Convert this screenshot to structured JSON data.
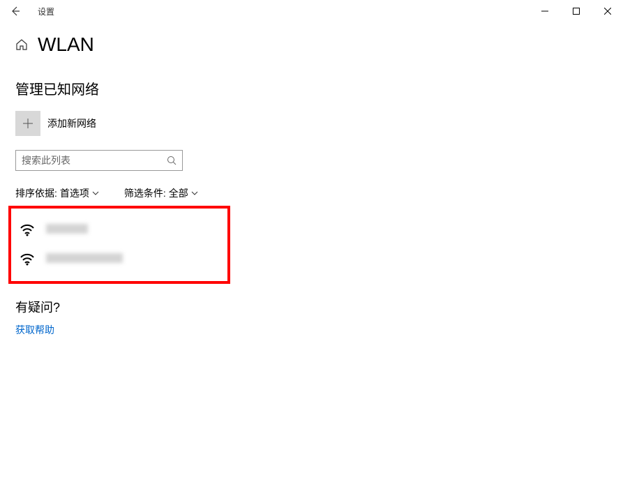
{
  "titlebar": {
    "app_title": "设置"
  },
  "header": {
    "page_title": "WLAN"
  },
  "section": {
    "manage_networks_title": "管理已知网络",
    "add_network_label": "添加新网络"
  },
  "search": {
    "placeholder": "搜索此列表"
  },
  "sort": {
    "label": "排序依据:",
    "value": "首选项"
  },
  "filter": {
    "label": "筛选条件:",
    "value": "全部"
  },
  "networks": [
    {
      "name": ""
    },
    {
      "name": ""
    }
  ],
  "help": {
    "question_title": "有疑问?",
    "help_link": "获取帮助"
  }
}
